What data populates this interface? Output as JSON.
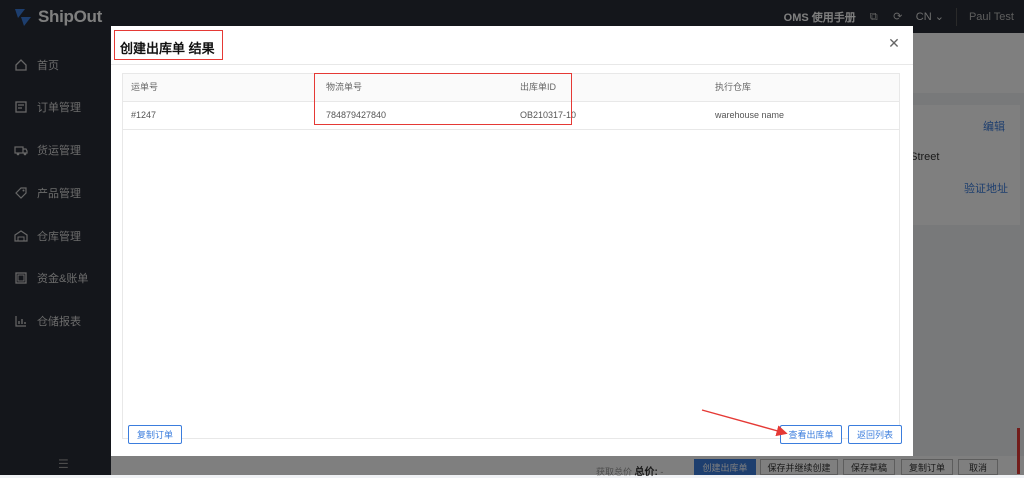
{
  "brand": {
    "name": "ShipOut"
  },
  "header": {
    "manual_link": "OMS 使用手册",
    "language": "CN",
    "user": "Paul Test"
  },
  "sidebar": {
    "items": [
      {
        "label": "首页",
        "icon": "home-icon"
      },
      {
        "label": "订单管理",
        "icon": "order-icon"
      },
      {
        "label": "货运管理",
        "icon": "truck-icon"
      },
      {
        "label": "产品管理",
        "icon": "tag-icon"
      },
      {
        "label": "仓库管理",
        "icon": "warehouse-icon"
      },
      {
        "label": "资金&账单",
        "icon": "wallet-icon"
      },
      {
        "label": "仓储报表",
        "icon": "chart-icon"
      }
    ]
  },
  "background": {
    "edit_link": "编辑",
    "street_text": "t Street",
    "verify_link": "验证地址"
  },
  "modal": {
    "title": "创建出库单 结果",
    "columns": [
      "运单号",
      "物流单号",
      "出库单ID",
      "执行仓库"
    ],
    "rows": [
      [
        "#1247",
        "784879427840",
        "OB210317-10",
        "warehouse name"
      ]
    ],
    "copy_button": "复制订单",
    "view_button": "查看出库单",
    "back_button": "返回列表"
  },
  "bottom_bar": {
    "fetch_label": "获取总价",
    "total_label": "总价:",
    "total_value": "-",
    "buttons": [
      "创建出库单",
      "保存并继续创建",
      "保存草稿",
      "复制订单",
      "取消"
    ]
  },
  "colors": {
    "sidebar_bg": "#282c36",
    "accent": "#3b7ddd",
    "highlight": "#e53935"
  }
}
